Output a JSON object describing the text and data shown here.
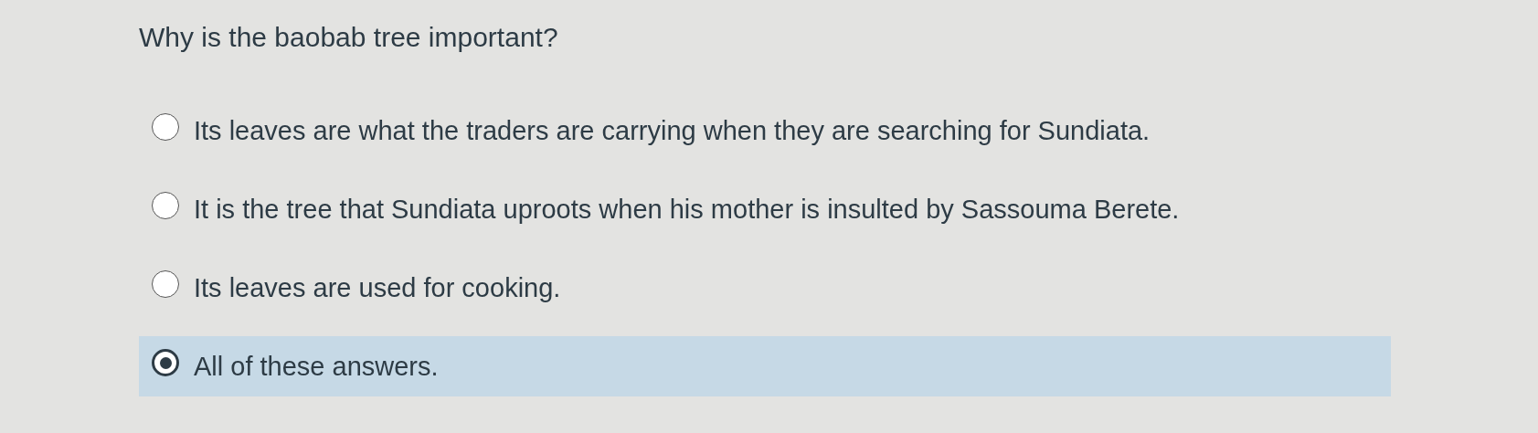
{
  "question": "Why is the baobab tree important?",
  "options": [
    {
      "label": "Its leaves are what the traders are carrying when they are searching for Sundiata.",
      "selected": false
    },
    {
      "label": "It is the tree that Sundiata uproots when his mother is insulted by Sassouma Berete.",
      "selected": false
    },
    {
      "label": "Its leaves are used for cooking.",
      "selected": false
    },
    {
      "label": "All of these answers.",
      "selected": true
    }
  ]
}
